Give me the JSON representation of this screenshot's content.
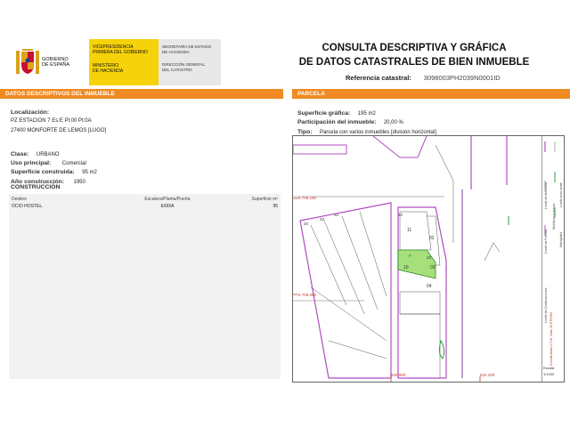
{
  "header": {
    "logo": {
      "gov_line1": "GOBIERNO",
      "gov_line2": "DE ESPAÑA",
      "mid_line1": "VICEPRESIDENCIA",
      "mid_line2": "PRIMERA DEL GOBIERNO",
      "mid_line3": "MINISTERIO",
      "mid_line4": "DE HACIENDA",
      "right_line1": "SECRETARÍA DE ESTADO",
      "right_line2": "DE HACIENDA",
      "right_line3": "DIRECCIÓN GENERAL",
      "right_line4": "DEL CATASTRO"
    },
    "title_line1": "CONSULTA DESCRIPTIVA Y GRÁFICA",
    "title_line2": "DE DATOS CATASTRALES DE BIEN INMUEBLE",
    "refcat_label": "Referencia catastral:",
    "refcat_value": "3098003PH2039N0001ID"
  },
  "left": {
    "bar_title": "DATOS DESCRIPTIVOS DEL INMUEBLE",
    "localizacion_label": "Localización:",
    "address_line1": "PZ ESTACION 7 Es:E Pl:00 Pt:0A",
    "address_line2": "27400 MONFORTE DE LEMOS [LUGO]",
    "clase_label": "Clase:",
    "clase_value": "URBANO",
    "uso_label": "Uso principal:",
    "uso_value": "Comercial",
    "superficie_label": "Superficie construida:",
    "superficie_value": "95 m2",
    "anio_label": "Año construcción:",
    "anio_value": "1950",
    "construccion_title": "CONSTRUCCIÓN",
    "table": {
      "headers": [
        "Destino",
        "Escalera/Planta/Puerta",
        "Superficie m²"
      ],
      "rows": [
        [
          "OCIO HOSTEL.",
          "E/00/A",
          "95"
        ]
      ]
    }
  },
  "right": {
    "bar_title": "PARCELA",
    "sup_label": "Superficie gráfica:",
    "sup_value": "195 m2",
    "part_label": "Participación del inmueble:",
    "part_value": "20,00 %",
    "tipo_label": "Tipo:",
    "tipo_value": "Parcela con varios inmuebles [división horizontal]"
  },
  "map": {
    "coord_y1": "4.709.100",
    "coord_y2": "4.709.050",
    "coord_x1": "622.050",
    "coord_x2": "622.100",
    "parcel_label": "F",
    "parcel_nums": [
      "11",
      "10",
      "02",
      "03",
      "04",
      "32",
      "32"
    ],
    "street_nums": [
      "34",
      "33",
      "32"
    ],
    "legend": {
      "item1": "Límite de Manzana",
      "item2": "Límite de Parcela",
      "item3": "Límite de Construcciones",
      "item4": "Mobiliario y aceras",
      "item5": "Límite zona verde",
      "item6": "Hidrografía",
      "coord_note": "Coordenadas U.T.M. Huso 29 ETRS89",
      "scale_label": "Escala:",
      "scale_value": "1/1000"
    }
  },
  "colors": {
    "accent": "#f08a22",
    "parcel_fill": "#a6e07a",
    "block_outline": "#b04cc0",
    "road_outline": "#9b59b6",
    "water": "#2ea043"
  }
}
